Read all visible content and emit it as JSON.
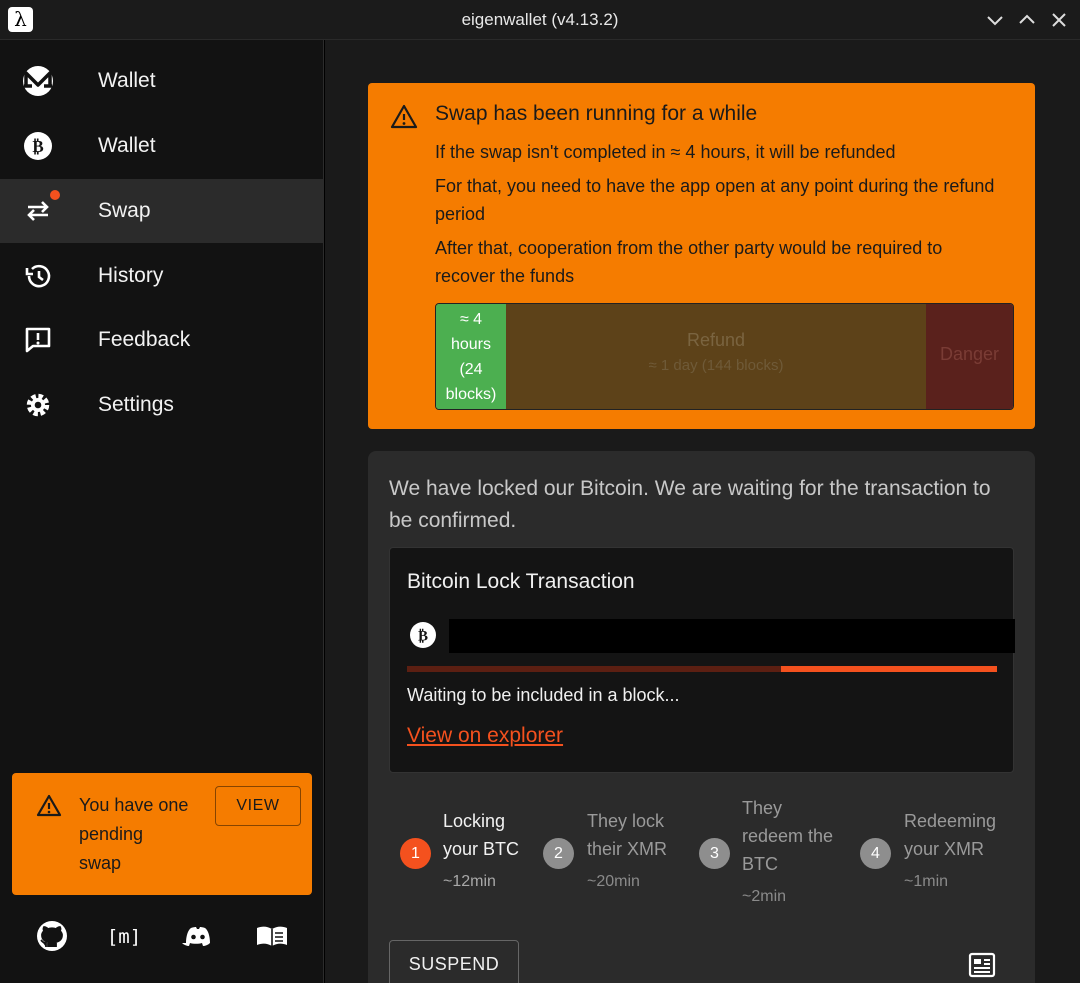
{
  "window": {
    "title": "eigenwallet (v4.13.2)",
    "app_glyph": "λ"
  },
  "sidebar": {
    "items": [
      {
        "label": "Wallet",
        "icon": "monero-icon"
      },
      {
        "label": "Wallet",
        "icon": "bitcoin-icon"
      },
      {
        "label": "Swap",
        "icon": "swap-arrows-icon",
        "active": true,
        "notification": true
      },
      {
        "label": "History",
        "icon": "history-icon"
      },
      {
        "label": "Feedback",
        "icon": "feedback-icon"
      },
      {
        "label": "Settings",
        "icon": "gear-icon"
      }
    ],
    "pending": {
      "line1": "You have one",
      "line2": "pending",
      "line3": "swap",
      "button": "VIEW"
    },
    "footer_icons": [
      "github-icon",
      "matrix-icon",
      "discord-icon",
      "docs-book-icon"
    ],
    "matrix_glyph": "[m]"
  },
  "alert": {
    "title": "Swap has been running for a while",
    "line1": "If the swap isn't completed in ≈ 4 hours, it will be refunded",
    "line2": "For that, you need to have the app open at any point during the refund period",
    "line3": "After that, cooperation from the other party would be required to recover the funds",
    "timeline": {
      "green_1": "≈ 4",
      "green_2": "hours",
      "green_3": "(24",
      "green_4": "blocks)",
      "refund_title": "Refund",
      "refund_sub": "≈ 1 day (144 blocks)",
      "danger": "Danger"
    }
  },
  "status": {
    "message": "We have locked our Bitcoin. We are waiting for the transaction to be confirmed.",
    "tx": {
      "title": "Bitcoin Lock Transaction",
      "status": "Waiting to be included in a block...",
      "link": "View on explorer",
      "progress": 0.634
    }
  },
  "steps": [
    {
      "num": "1",
      "l1": "Locking",
      "l2": "your BTC",
      "l3": "",
      "time": "~12min",
      "active": true
    },
    {
      "num": "2",
      "l1": "They lock",
      "l2": "their XMR",
      "l3": "",
      "time": "~20min",
      "active": false
    },
    {
      "num": "3",
      "l1": "They",
      "l2": "redeem the",
      "l3": "BTC",
      "time": "~2min",
      "active": false
    },
    {
      "num": "4",
      "l1": "Redeeming",
      "l2": "your XMR",
      "l3": "",
      "time": "~1min",
      "active": false
    }
  ],
  "actions": {
    "suspend": "SUSPEND"
  },
  "colors": {
    "accent": "#f57c00",
    "active_step": "#f4511e",
    "success": "#4caf50"
  }
}
